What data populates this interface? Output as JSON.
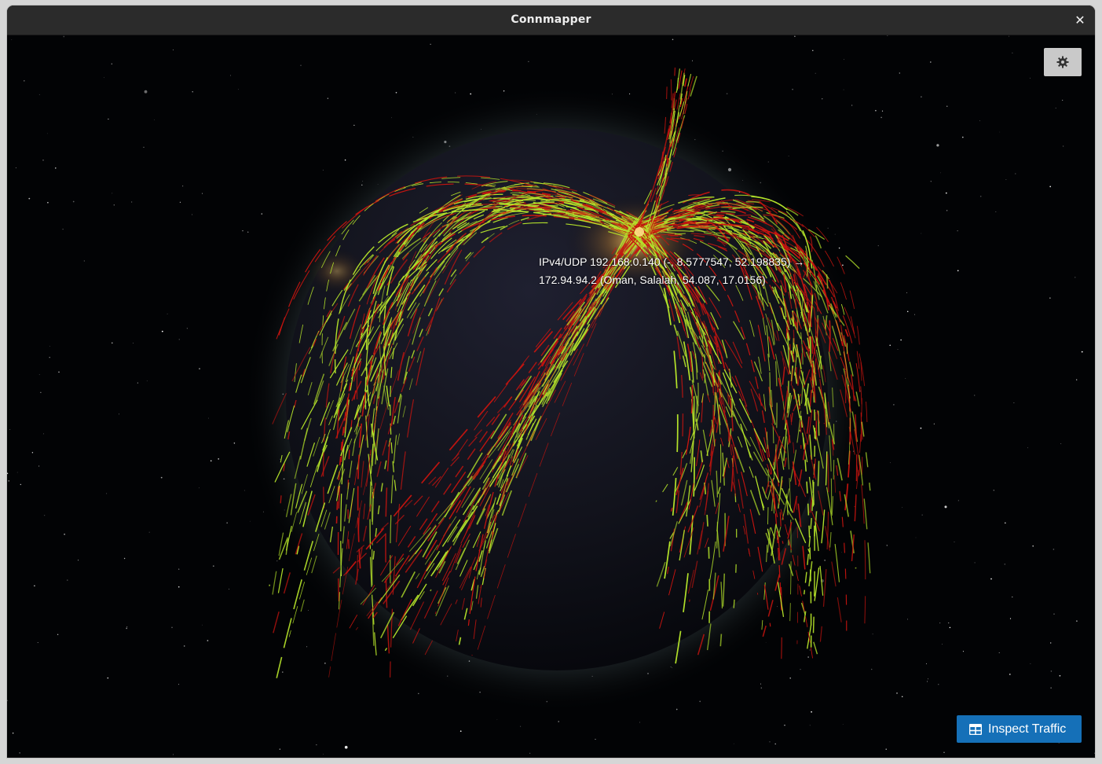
{
  "window": {
    "title": "Connmapper",
    "close_glyph": "✕"
  },
  "toolbar": {
    "settings_icon": "gear-icon",
    "inspect_label": "Inspect Traffic",
    "inspect_icon": "table-icon"
  },
  "connection": {
    "line1": "IPv4/UDP 192.168.0.140 (-, 8.5777547, 52.198835) →",
    "line2": "172.94.94.2 (Oman, Salalah, 54.087, 17.0156)"
  },
  "colors": {
    "arc_red": "#c8140f",
    "arc_yellow": "#b5e32a",
    "button_blue": "#1570b8",
    "settings_bg": "#c9c9c9",
    "titlebar": "#2b2b2b"
  }
}
